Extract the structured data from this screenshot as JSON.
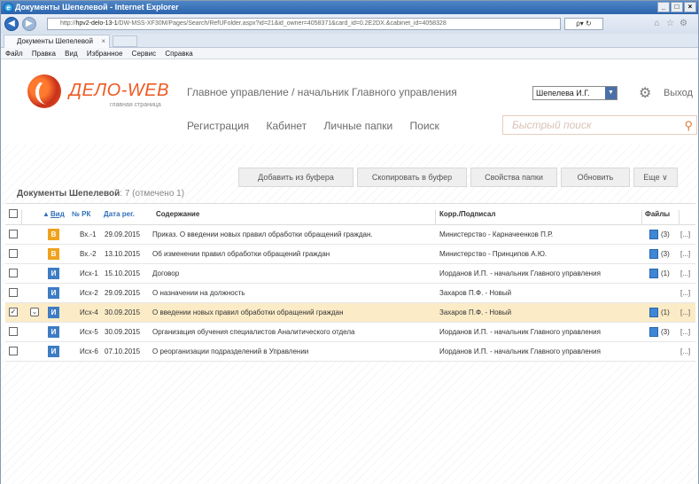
{
  "browser": {
    "window_title": "Документы Шепелевой - Internet Explorer",
    "address_prefix": "http://",
    "address_host": "hpv2-delo-13-1",
    "address_rest": "/DW-MSS-XF30M/Pages/Search/RefUFolder.aspx?id=21&id_owner=4058371&card_id=0.2E2DX.&cabinet_id=4058328",
    "address_go": "ρ▾ ↻",
    "tab_label": "Документы Шепелевой",
    "tab_close": "×",
    "menu": [
      "Файл",
      "Правка",
      "Вид",
      "Избранное",
      "Сервис",
      "Справка"
    ],
    "win_buttons": [
      "_",
      "□",
      "×"
    ]
  },
  "app": {
    "logo_text": "ДЕЛО-WEB",
    "logo_sub": "главная страница",
    "org_path": "Главное управление / начальник Главного управления",
    "user": "Шепелева И.Г.",
    "exit_label": "Выход",
    "nav": [
      "Регистрация",
      "Кабинет",
      "Личные папки",
      "Поиск"
    ],
    "quick_search_placeholder": "Быстрый поиск"
  },
  "toolbar": {
    "add_from_buffer": "Добавить из буфера",
    "copy_to_buffer": "Скопировать в буфер",
    "folder_props": "Свойства папки",
    "refresh": "Обновить",
    "more": "Еще ∨"
  },
  "list": {
    "title": "Документы Шепелевой",
    "count": ": 7 (отмечено 1)",
    "headers": {
      "sort": "▲",
      "vid": "Вид",
      "num": "№ РК",
      "date": "Дата рег.",
      "content": "Содержание",
      "corr": "Корр./Подписал",
      "files": "Файлы"
    },
    "rows": [
      {
        "vid": "В",
        "vid_color": "#f0a21e",
        "num": "Вх.-1",
        "date": "29.09.2015",
        "content": "Приказ. О введении новых правил обработки обращений граждан.",
        "corr": "Министерство - Карначеенков П.Р.",
        "files": "(3)",
        "more": "[...]",
        "selected": false,
        "has_file": true
      },
      {
        "vid": "В",
        "vid_color": "#f0a21e",
        "num": "Вх.-2",
        "date": "13.10.2015",
        "content": "Об изменении правил обработки обращений граждан",
        "corr": "Министерство - Принципов А.Ю.",
        "files": "(3)",
        "more": "[...]",
        "selected": false,
        "has_file": true
      },
      {
        "vid": "И",
        "vid_color": "#3e7cc4",
        "num": "Исх-1",
        "date": "15.10.2015",
        "content": "Договор",
        "corr": "Иорданов И.П. - начальник Главного управления",
        "files": "(1)",
        "more": "[...]",
        "selected": false,
        "has_file": true
      },
      {
        "vid": "И",
        "vid_color": "#3e7cc4",
        "num": "Исх-2",
        "date": "29.09.2015",
        "content": "О назначении на должность",
        "corr": "Захаров П.Ф. - Новый",
        "files": "",
        "more": "[...]",
        "selected": false,
        "has_file": false
      },
      {
        "vid": "И",
        "vid_color": "#3e7cc4",
        "num": "Исх-4",
        "date": "30.09.2015",
        "content": "О введении новых правил обработки обращений граждан",
        "corr": "Захаров П.Ф. - Новый",
        "files": "(1)",
        "more": "[...]",
        "selected": true,
        "has_file": true
      },
      {
        "vid": "И",
        "vid_color": "#3e7cc4",
        "num": "Исх-5",
        "date": "30.09.2015",
        "content": "Организация обучения специалистов Аналитического отдела",
        "corr": "Иорданов И.П. - начальник Главного управления",
        "files": "(3)",
        "more": "[...]",
        "selected": false,
        "has_file": true
      },
      {
        "vid": "И",
        "vid_color": "#3e7cc4",
        "num": "Исх-6",
        "date": "07.10.2015",
        "content": "О реорганизации подразделений в Управлении",
        "corr": "Иорданов И.П. - начальник Главного управления",
        "files": "",
        "more": "[...]",
        "selected": false,
        "has_file": false
      }
    ]
  }
}
